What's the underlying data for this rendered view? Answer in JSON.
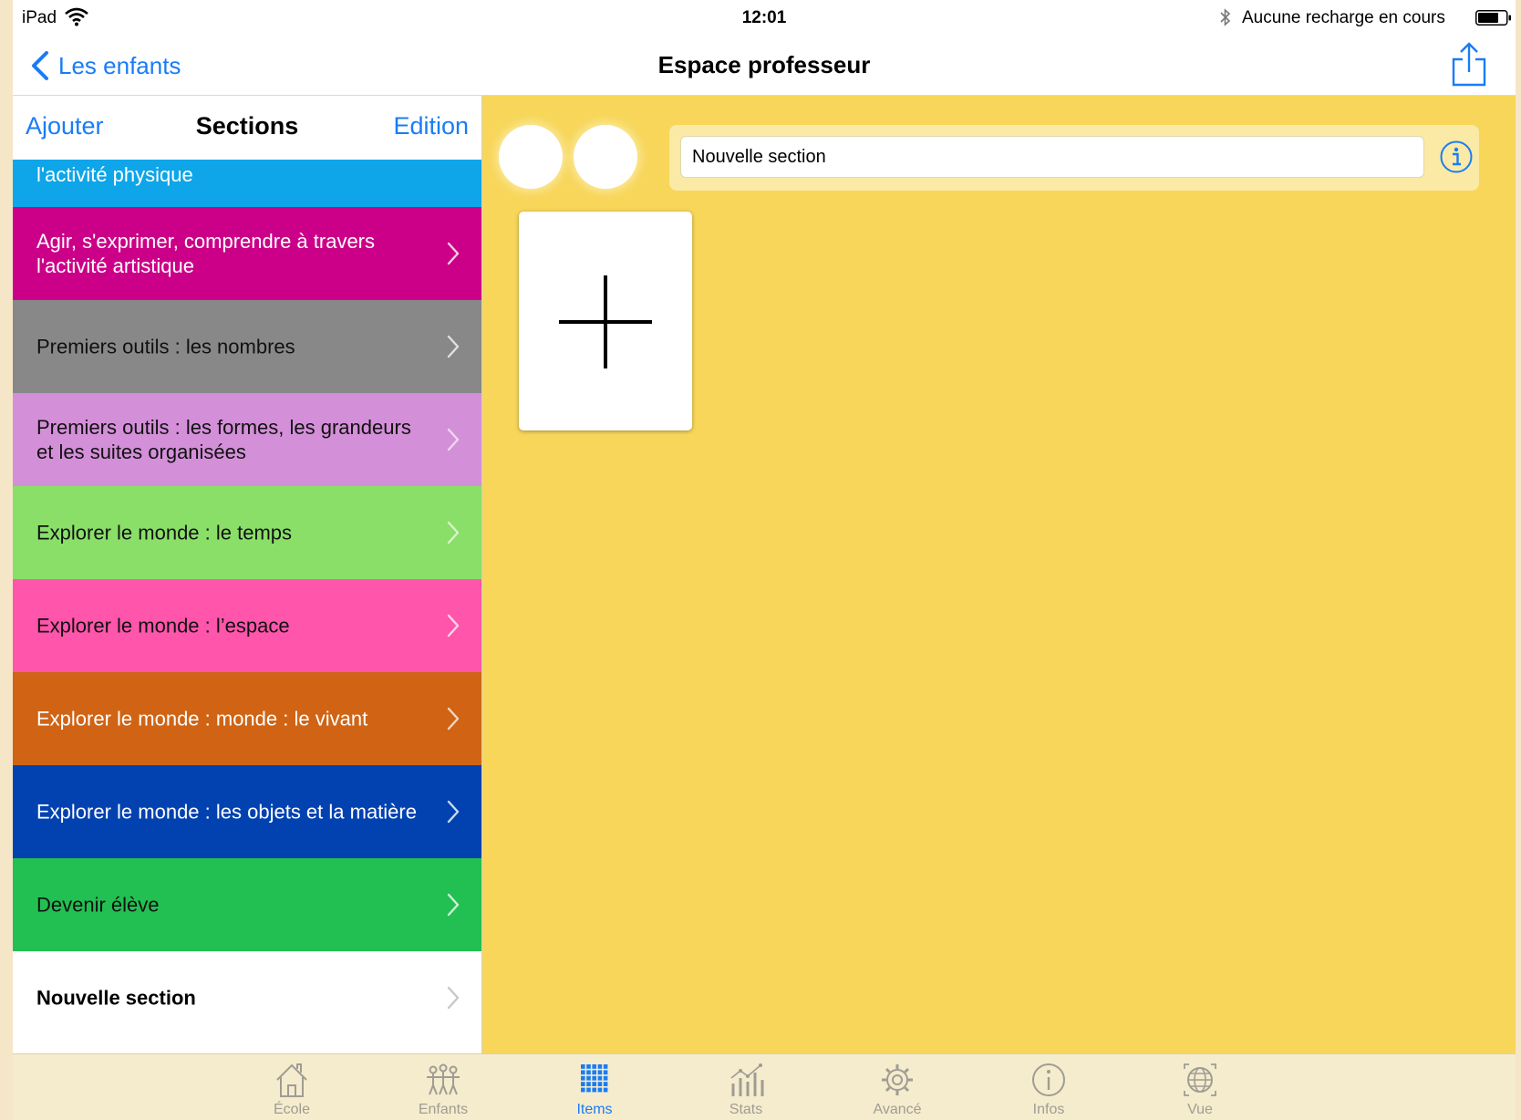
{
  "status_bar": {
    "device": "iPad",
    "time": "12:01",
    "charge_status": "Aucune recharge en cours"
  },
  "nav_bar": {
    "back_label": "Les enfants",
    "title": "Espace professeur"
  },
  "sidebar": {
    "add_label": "Ajouter",
    "title": "Sections",
    "edit_label": "Edition",
    "sections": [
      {
        "label": "l'activité physique",
        "color": "#0ea5e9",
        "text_color": "#ffffff",
        "chevron_color": "#cfe8f7"
      },
      {
        "label": "Agir, s'exprimer, comprendre à travers l'activité artistique",
        "color": "#cc0088",
        "text_color": "#ffffff",
        "chevron_color": "#f2cfe4"
      },
      {
        "label": "Premiers outils : les nombres",
        "color": "#888888",
        "text_color": "#111111",
        "chevron_color": "#e0e0e0"
      },
      {
        "label": "Premiers outils : les formes, les grandeurs et les suites organisées",
        "color": "#d48fd9",
        "text_color": "#111111",
        "chevron_color": "#efd6f1"
      },
      {
        "label": "Explorer le monde : le temps",
        "color": "#89df68",
        "text_color": "#111111",
        "chevron_color": "#d9f3cd"
      },
      {
        "label": "Explorer le monde : l’espace",
        "color": "#ff55aa",
        "text_color": "#111111",
        "chevron_color": "#ffd4ea"
      },
      {
        "label": "Explorer le monde : monde : le vivant",
        "color": "#d06414",
        "text_color": "#ffffff",
        "chevron_color": "#f3d6c0"
      },
      {
        "label": "Explorer le monde : les objets et la matière",
        "color": "#0242b0",
        "text_color": "#ffffff",
        "chevron_color": "#cbd8f0"
      },
      {
        "label": "Devenir élève",
        "color": "#22c052",
        "text_color": "#111111",
        "chevron_color": "#cdf0d7"
      },
      {
        "label": "Nouvelle section",
        "color": "#ffffff",
        "text_color": "#000000",
        "chevron_color": "#c7c7cc",
        "bold": true
      }
    ]
  },
  "main": {
    "section_name_value": "Nouvelle section",
    "background_color": "#f7d65a"
  },
  "tab_bar": {
    "tabs": [
      {
        "label": "École",
        "icon": "house-icon",
        "active": false
      },
      {
        "label": "Enfants",
        "icon": "children-icon",
        "active": false
      },
      {
        "label": "Items",
        "icon": "grid-icon",
        "active": true
      },
      {
        "label": "Stats",
        "icon": "stats-icon",
        "active": false
      },
      {
        "label": "Avancé",
        "icon": "gear-icon",
        "active": false
      },
      {
        "label": "Infos",
        "icon": "info-icon",
        "active": false
      },
      {
        "label": "Vue",
        "icon": "globe-icon",
        "active": false
      }
    ]
  },
  "colors": {
    "accent": "#1a7cf5",
    "tab_inactive": "#a09c94",
    "tab_bar_bg": "#f5eccd"
  }
}
